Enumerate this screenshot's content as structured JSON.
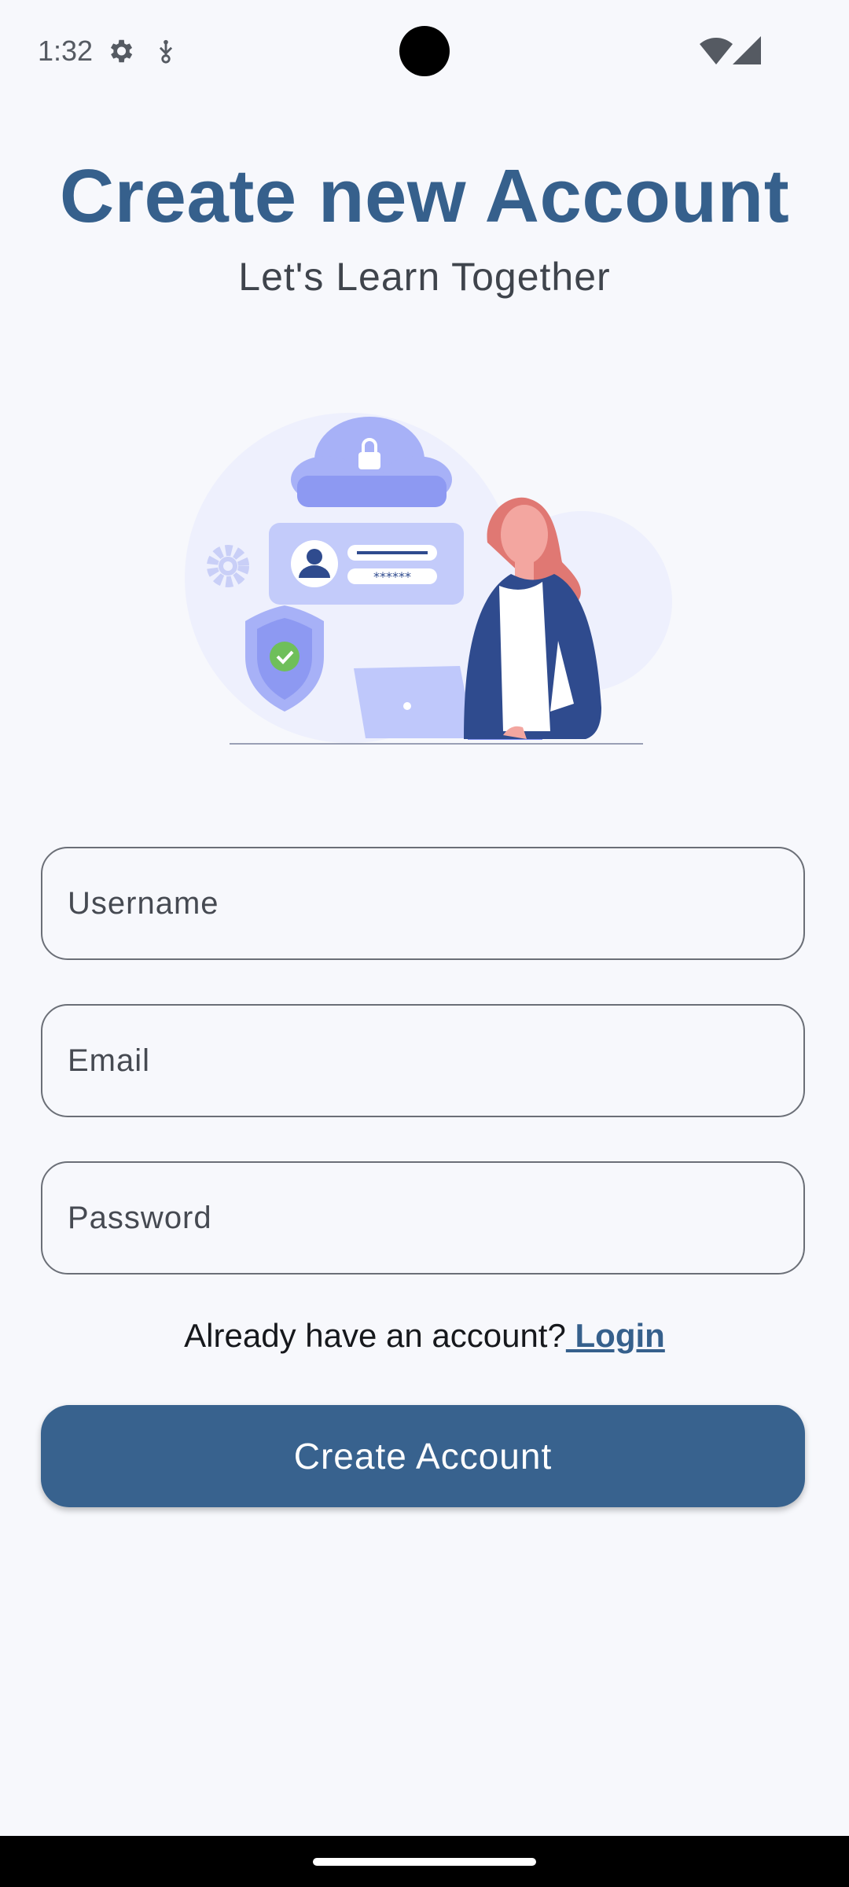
{
  "status_bar": {
    "time": "1:32",
    "icons": [
      "settings-gear-icon",
      "usb-debug-icon",
      "wifi-icon",
      "cell-signal-icon"
    ]
  },
  "header": {
    "title": "Create new Account",
    "subtitle": "Let's Learn Together"
  },
  "illustration": {
    "name": "account-security-illustration",
    "icons": [
      "cloud-lock-icon",
      "profile-card-icon",
      "gear-icon",
      "shield-check-icon",
      "laptop-icon",
      "woman-figure"
    ],
    "password_mask": "******"
  },
  "form": {
    "username_placeholder": "Username",
    "email_placeholder": "Email",
    "password_placeholder": "Password"
  },
  "login_prompt": {
    "text": "Already have an account?",
    "link": " Login"
  },
  "create_button": {
    "label": "Create Account"
  },
  "colors": {
    "accent": "#36608C",
    "background": "#F7F8FC",
    "illustration_blue": "#7E8EF0",
    "jacket": "#2F4B8E",
    "hair": "#E07873"
  }
}
